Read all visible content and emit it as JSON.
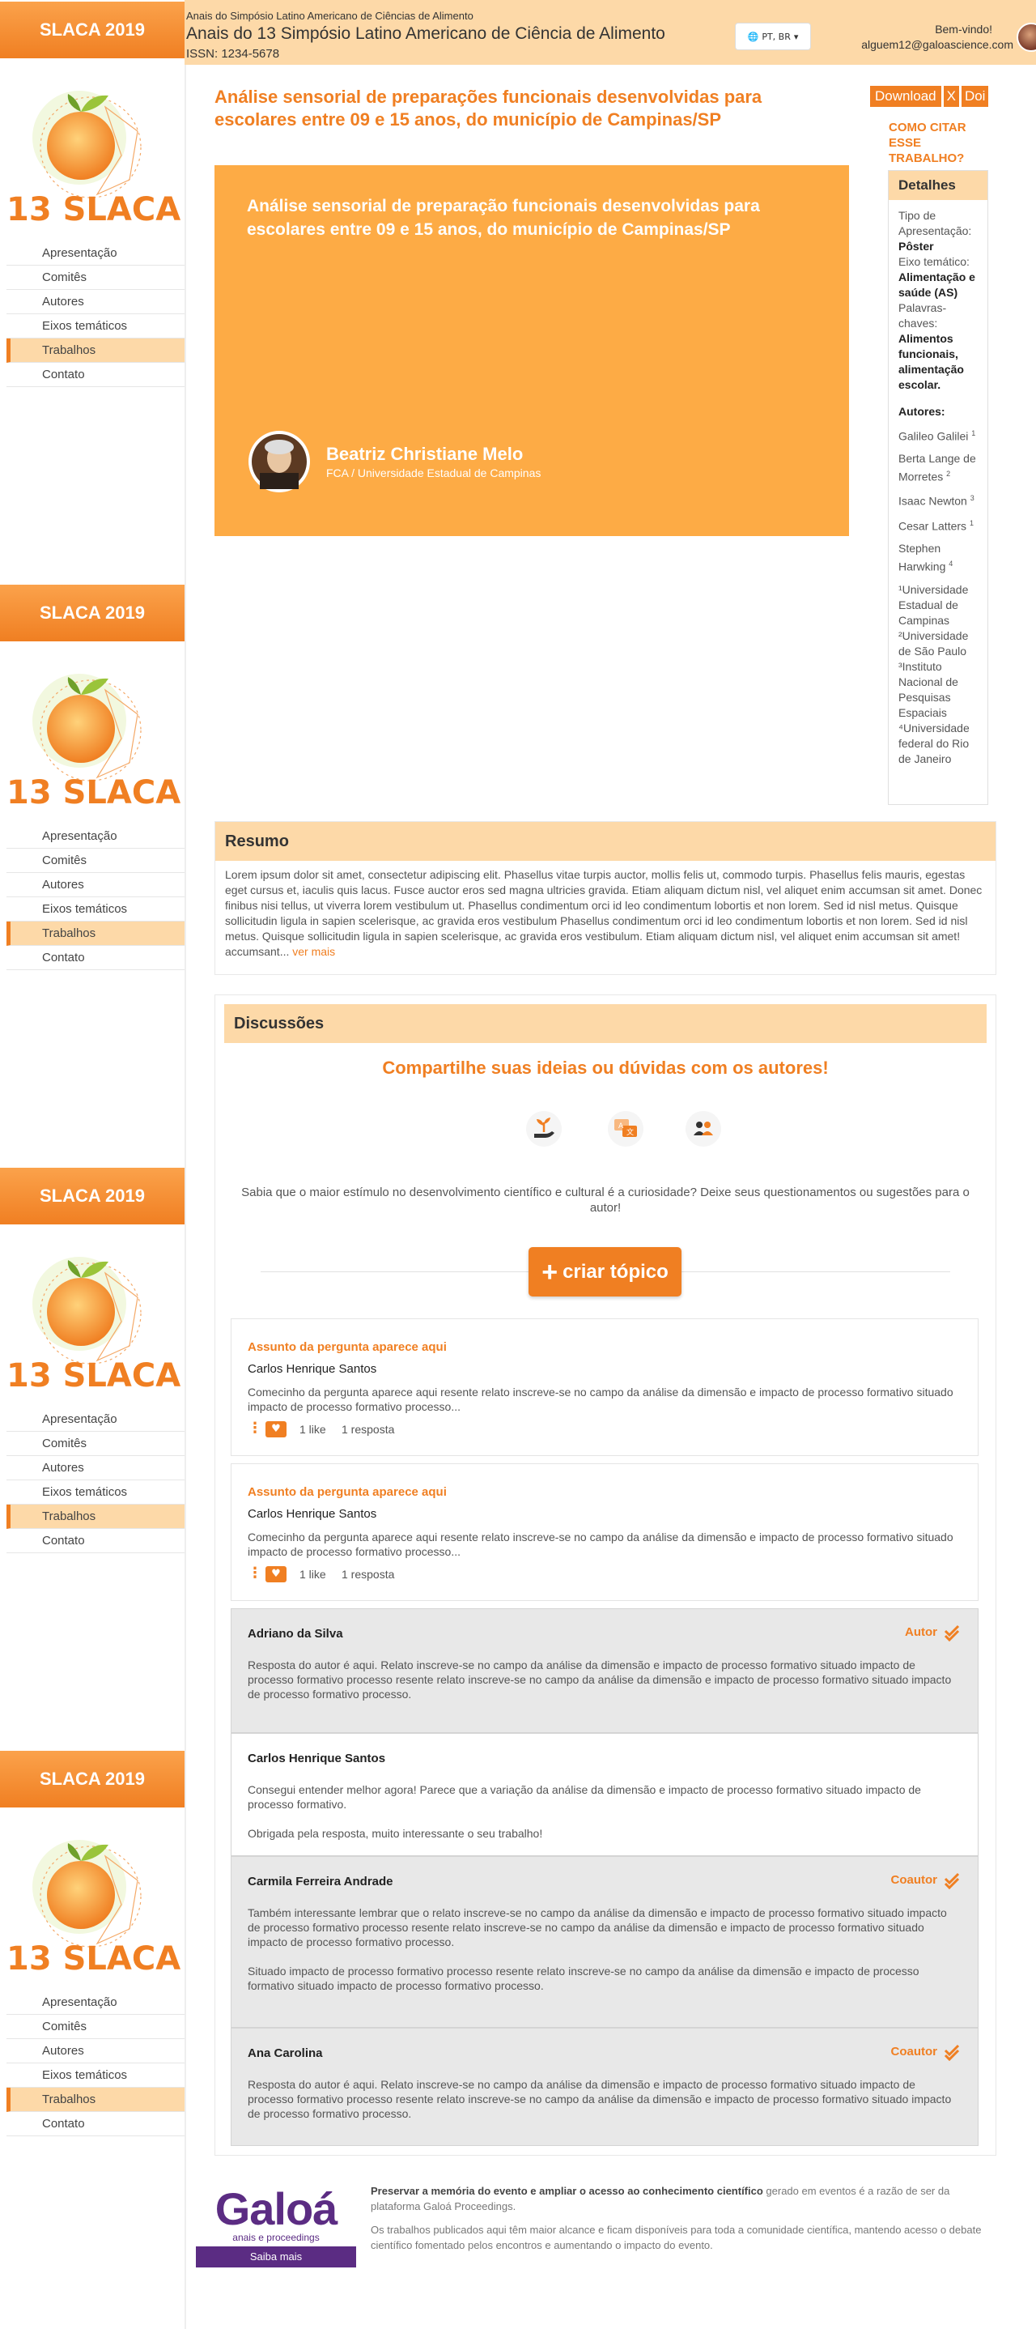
{
  "header": {
    "subtitle": "Anais do Simpósio Latino Americano de Ciências de Alimento",
    "title": "Anais do 13 Simpósio Latino Americano de Ciência de Alimento",
    "issn": "ISSN: 1234-5678",
    "lang": "PT, BR",
    "welcome": "Bem-vindo!",
    "email": "alguem12@galoascience.com"
  },
  "sidebar": {
    "banner": "SLACA 2019",
    "logo_text": "13 SLACA",
    "items": [
      "Apresentação",
      "Comitês",
      "Autores",
      "Eixos temáticos",
      "Trabalhos",
      "Contato"
    ],
    "active_index": 4
  },
  "paper": {
    "title": "Análise sensorial de preparações funcionais desenvolvidas para escolares entre 09 e 15 anos, do município de Campinas/SP",
    "card_title": "Análise sensorial de preparação funcionais desenvolvidas para escolares entre 09 e 15 anos, do município de Campinas/SP",
    "author_name": "Beatriz Christiane Melo",
    "author_affiliation": "FCA / Universidade Estadual de Campinas"
  },
  "actions": {
    "download": "Download",
    "x": "X",
    "doi": "Doi",
    "cite": "COMO CITAR ESSE TRABALHO?"
  },
  "details": {
    "title": "Detalhes",
    "type_label": "Tipo de Apresentação:",
    "type_value": "Pôster",
    "axis_label": "Eixo temático:",
    "axis_value": "Alimentação e saúde (AS)",
    "keywords_label": "Palavras-chaves:",
    "keywords_value": "Alimentos funcionais, alimentação escolar.",
    "authors_label": "Autores:",
    "authors": [
      {
        "name": "Galileo Galilei",
        "sup": "1"
      },
      {
        "name": "Berta Lange de Morretes",
        "sup": "2"
      },
      {
        "name": "Isaac Newton",
        "sup": "3"
      },
      {
        "name": "Cesar Latters",
        "sup": "1"
      },
      {
        "name": "Stephen Harwking",
        "sup": "4"
      }
    ],
    "affiliations": [
      "¹Universidade Estadual de Campinas",
      "²Universidade de São Paulo",
      "³Instituto Nacional de Pesquisas Espaciais",
      "⁴Universidade federal do Rio de Janeiro"
    ]
  },
  "abstract": {
    "title": "Resumo",
    "text": "Lorem ipsum dolor sit amet, consectetur adipiscing elit. Phasellus vitae turpis auctor, mollis felis ut, commodo turpis. Phasellus felis mauris, egestas eget cursus et, iaculis quis lacus. Fusce auctor eros sed magna ultricies gravida. Etiam aliquam dictum nisl, vel aliquet enim accumsan sit amet. Donec finibus nisi tellus, ut viverra lorem vestibulum ut. Phasellus condimentum orci id leo condimentum lobortis et non lorem. Sed id nisl metus. Quisque sollicitudin ligula in sapien scelerisque, ac gravida eros vestibulum Phasellus condimentum orci id leo condimentum lobortis et non lorem. Sed id nisl metus. Quisque sollicitudin ligula in sapien scelerisque, ac gravida eros vestibulum. Etiam aliquam dictum nisl, vel aliquet enim accumsan sit amet! accumsant...",
    "more": "ver mais"
  },
  "discussion": {
    "title": "Discussões",
    "headline": "Compartilhe suas ideias ou dúvidas com os autores!",
    "intro": "Sabia que o maior estímulo no desenvolvimento científico e cultural é a curiosidade? Deixe seus questionamentos ou sugestões para o autor!",
    "create": "criar tópico",
    "questions": [
      {
        "subject": "Assunto da pergunta aparece aqui",
        "author": "Carlos Henrique Santos",
        "text": "Comecinho da pergunta aparece aqui resente relato inscreve-se no campo da análise da dimensão e impacto de processo formativo situado impacto de processo formativo processo...",
        "likes": "1 like",
        "replies": "1 resposta"
      },
      {
        "subject": "Assunto da pergunta aparece aqui",
        "author": "Carlos Henrique Santos",
        "text": "Comecinho da pergunta aparece aqui resente relato inscreve-se no campo da análise da dimensão e impacto de processo formativo situado impacto de processo formativo processo...",
        "likes": "1 like",
        "replies": "1 resposta"
      }
    ],
    "answers": [
      {
        "author": "Adriano da Silva",
        "role": "Autor",
        "paragraphs": [
          "Resposta do autor é aqui. Relato inscreve-se no campo da análise da dimensão e impacto de processo formativo situado impacto de processo formativo processo resente relato inscreve-se no campo da análise da dimensão e impacto de processo formativo situado impacto de processo formativo processo."
        ]
      },
      {
        "author": "Carlos Henrique Santos",
        "role": "",
        "paragraphs": [
          "Consegui entender melhor agora! Parece que a variação da análise da dimensão e impacto de processo formativo situado impacto de processo formativo.",
          "Obrigada pela resposta, muito interessante o seu trabalho!"
        ]
      },
      {
        "author": "Carmila Ferreira Andrade",
        "role": "Coautor",
        "paragraphs": [
          "Também interessante lembrar que o relato inscreve-se no campo da análise da dimensão e impacto de processo formativo situado impacto de processo formativo processo resente relato inscreve-se no campo da análise da dimensão e impacto de processo formativo situado impacto de processo formativo processo.",
          "Situado impacto de processo formativo processo resente relato inscreve-se no campo da análise da dimensão e impacto de processo formativo situado impacto de processo formativo processo."
        ]
      },
      {
        "author": "Ana Carolina",
        "role": "Coautor",
        "paragraphs": [
          "Resposta do autor é aqui. Relato inscreve-se no campo da análise da dimensão e impacto de processo formativo situado impacto de processo formativo processo resente relato inscreve-se no campo da análise da dimensão e impacto de processo formativo situado impacto de processo formativo processo."
        ]
      }
    ]
  },
  "footer": {
    "brand": "Galoá",
    "brand_sub": "anais e proceedings",
    "saiba": "Saiba mais",
    "bold_text": "Preservar a memória do evento e ampliar o acesso ao conhecimento científico",
    "text1": " gerado em eventos é a razão de ser da plataforma Galoá Proceedings.",
    "text2": "Os trabalhos publicados aqui têm maior alcance e ficam disponíveis para toda a comunidade científica, mantendo acesso o debate científico fomentado pelos encontros e aumentando o impacto do evento."
  },
  "colors": {
    "accent": "#f07f22",
    "accent_light": "#fdd9a8",
    "card_orange": "#fdab45",
    "brand_purple": "#5b2c83"
  }
}
